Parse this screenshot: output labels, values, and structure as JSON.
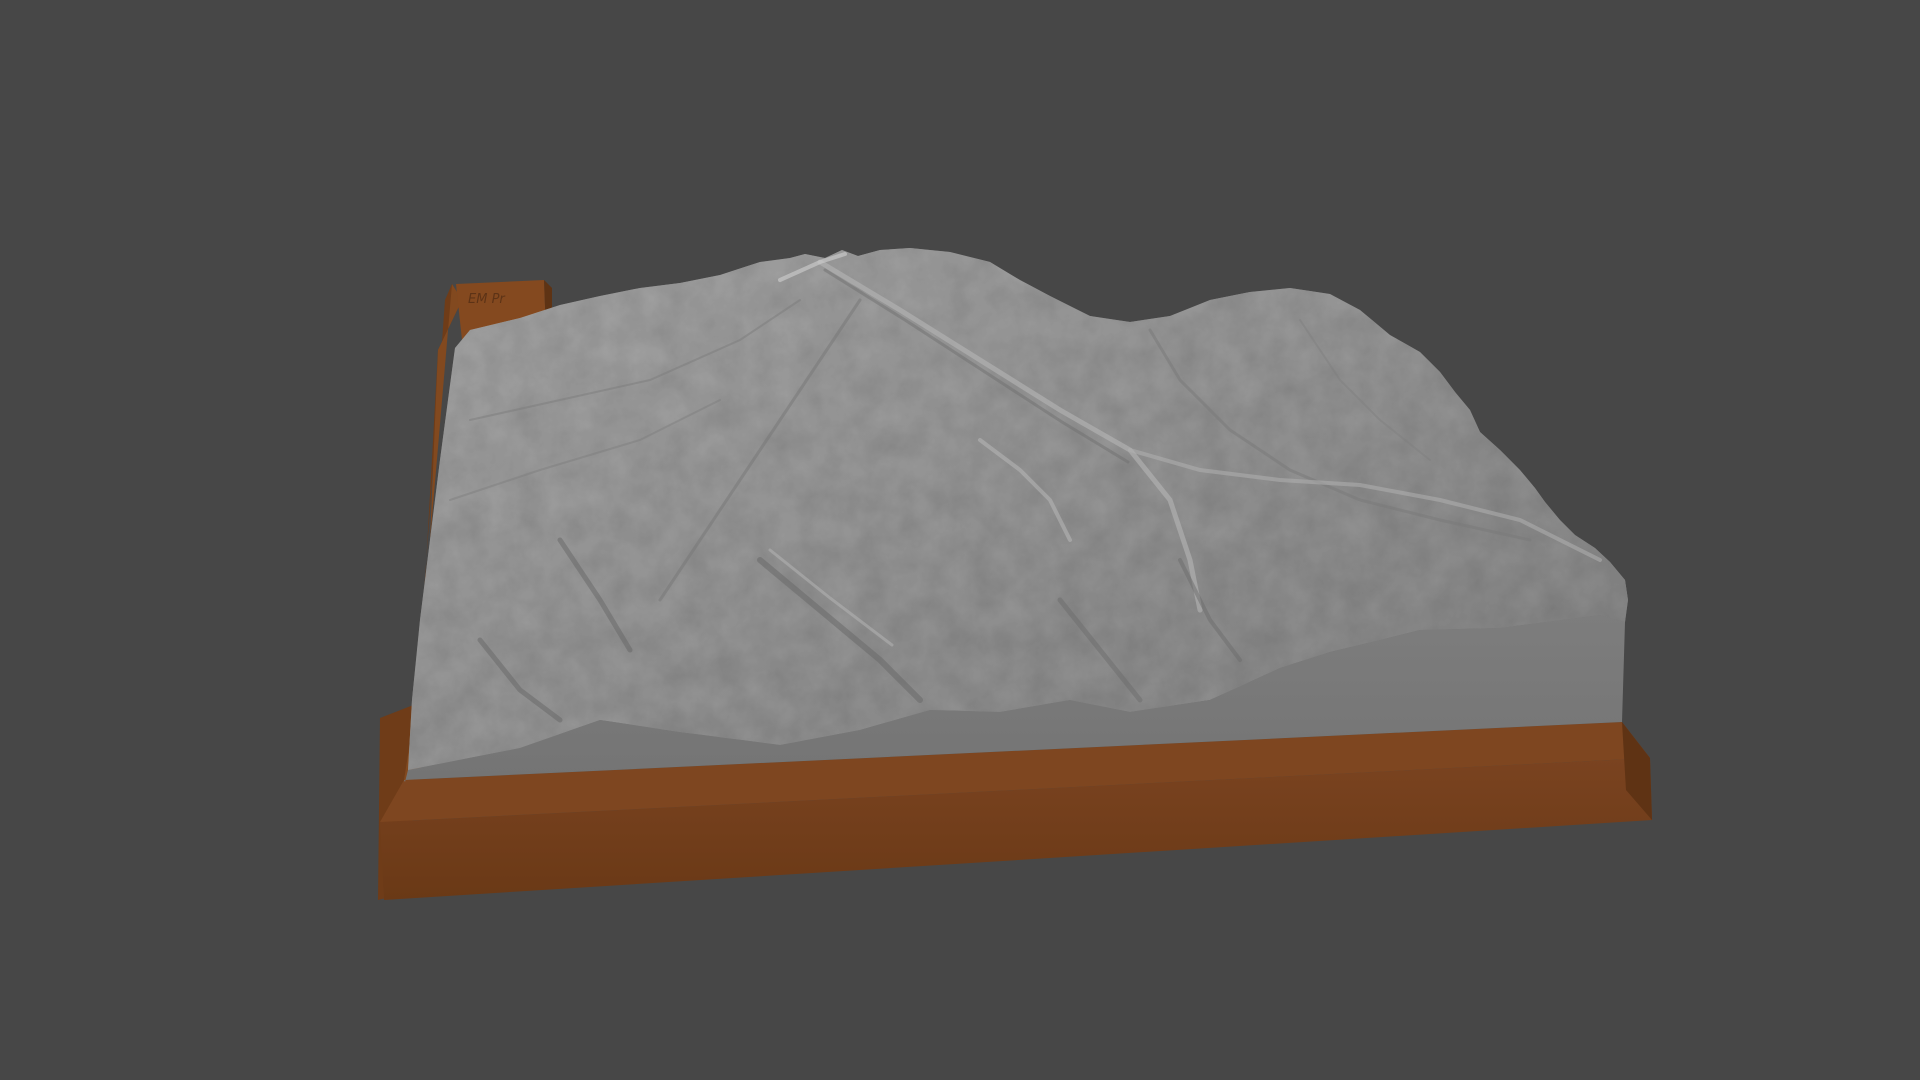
{
  "viewport": {
    "background_color": "#474747"
  },
  "model": {
    "kind": "3D terrain relief model on a base plate",
    "terrain_color": "#8f8f8f",
    "terrain_side_color": "#7a7a7a",
    "base_color": "#74401c",
    "base_side_color": "#5e3314",
    "base_top_color": "#80471f"
  },
  "label_tab": {
    "engraved_text": "EM Pr"
  }
}
